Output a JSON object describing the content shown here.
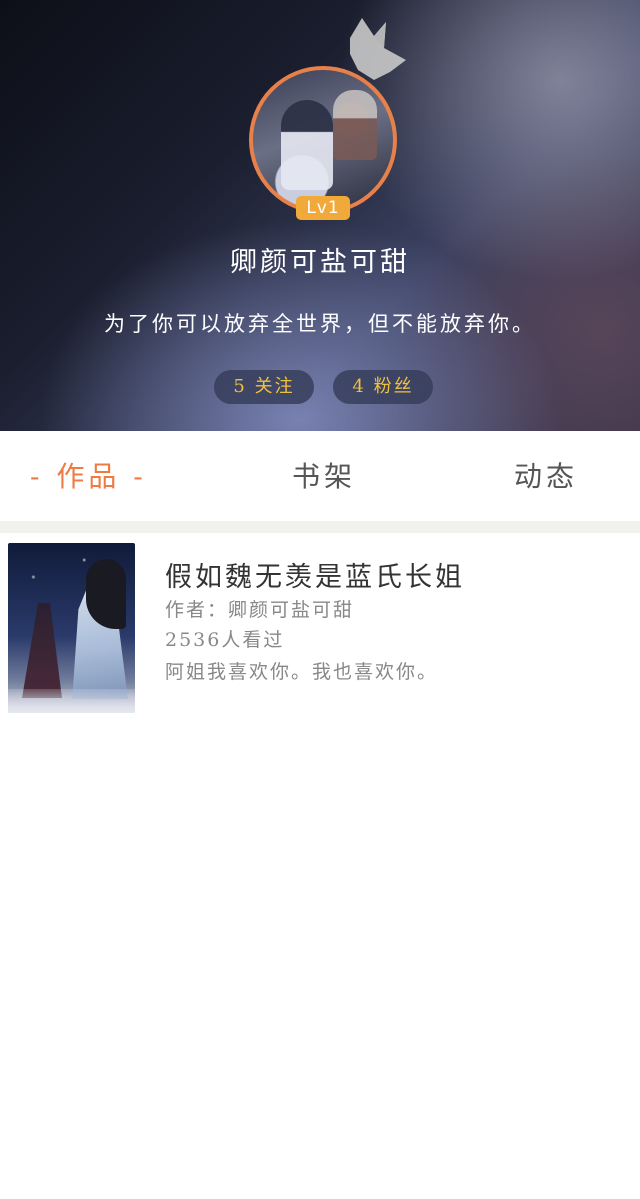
{
  "profile": {
    "level": "Lv1",
    "username": "卿颜可盐可甜",
    "signature": "为了你可以放弃全世界，但不能放弃你。",
    "follow_label": "5 关注",
    "fans_label": "4 粉丝"
  },
  "tabs": [
    {
      "label": "- 作品 -",
      "active": true
    },
    {
      "label": "书架",
      "active": false
    },
    {
      "label": "动态",
      "active": false
    }
  ],
  "books": [
    {
      "title": "假如魏无羡是蓝氏长姐",
      "author_line": "作者：卿颜可盐可甜",
      "views_line": "2536人看过",
      "description": "阿姐我喜欢你。我也喜欢你。"
    }
  ],
  "colors": {
    "accent": "#ee7b43",
    "level_badge": "#f1a93a",
    "pill_text": "#f0c040",
    "avatar_border": "#e8804a"
  },
  "icons": {
    "crown": "crown-icon"
  }
}
